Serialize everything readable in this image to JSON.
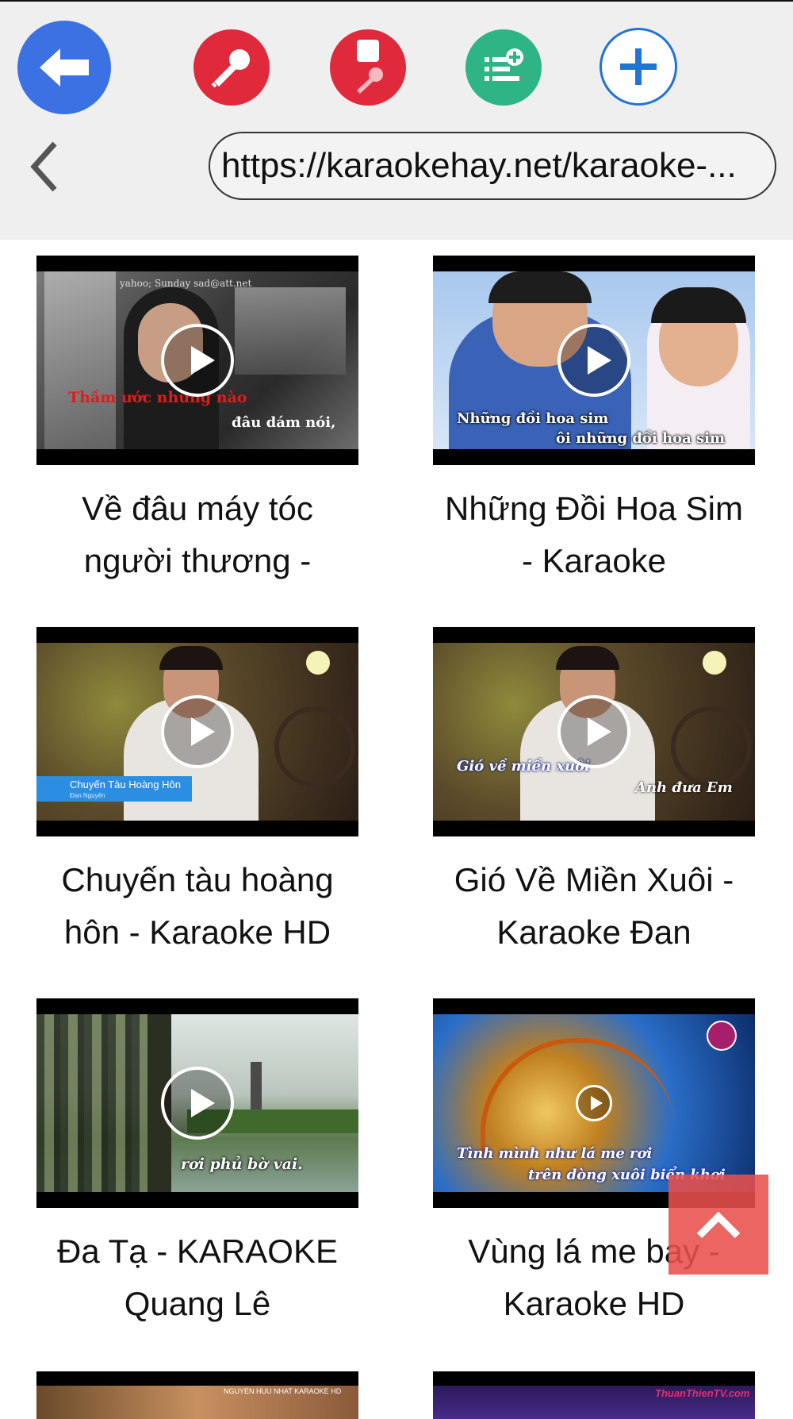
{
  "toolbar": {
    "buttons": [
      {
        "name": "back-arrow-button",
        "icon": "arrow-left-icon",
        "color": "#3b71e3"
      },
      {
        "name": "microphone-button",
        "icon": "microphone-icon",
        "color": "#e02a3c"
      },
      {
        "name": "stop-microphone-button",
        "icon": "microphone-stop-icon",
        "color": "#e02a3c"
      },
      {
        "name": "add-to-playlist-button",
        "icon": "playlist-add-icon",
        "color": "#2fb585"
      },
      {
        "name": "add-button",
        "icon": "plus-icon",
        "color": "#1f73d9"
      }
    ]
  },
  "browser": {
    "back_icon": "chevron-left-icon",
    "url": "https://karaokehay.net/karaoke-..."
  },
  "videos": [
    {
      "title": "Về đâu máy tóc người thương -",
      "title_line1": "Về đâu máy tóc",
      "title_line2": "người thương -",
      "overlay_top": "yahoo; Sunday sad@att.net",
      "overlay_red": "Thầm ước nhưng nào",
      "overlay_white": "đâu dám nói,"
    },
    {
      "title": "Những Đồi Hoa Sim - Karaoke",
      "title_line1": "Những Đồi Hoa Sim",
      "title_line2": "- Karaoke",
      "overlay_line1": "Những đồi hoa sim",
      "overlay_line2": "ôi những đồi hoa sim"
    },
    {
      "title": "Chuyến tàu hoàng hôn - Karaoke HD",
      "title_line1": "Chuyến tàu hoàng",
      "title_line2": "hôn - Karaoke HD",
      "overlay_banner": "Chuyến Tàu Hoàng Hôn",
      "overlay_banner_sub": "Đan Nguyên"
    },
    {
      "title": "Gió Về Miền Xuôi - Karaoke Đan",
      "title_line1": "Gió Về Miền Xuôi -",
      "title_line2": "Karaoke Đan",
      "overlay_line1": "Gió về miền xuôi",
      "overlay_line2": "Anh đưa Em"
    },
    {
      "title": "Đa Tạ - KARAOKE Quang Lê",
      "title_line1": "Đa Tạ - KARAOKE",
      "title_line2": "Quang Lê",
      "overlay_line1": "rơi phủ bờ vai."
    },
    {
      "title": "Vùng lá me bay - Karaoke HD",
      "title_line1": "Vùng lá me bay -",
      "title_line2": "Karaoke HD",
      "overlay_line1": "Tình mình như lá me rơi",
      "overlay_line2": "trên dòng xuôi biển khơi"
    }
  ],
  "partial_row": {
    "left_overlay": "NGUYEN HUU NHAT KARAOKE HD",
    "right_overlay": "ThuanThienTV.com"
  },
  "scroll_top_icon": "chevron-up-icon"
}
